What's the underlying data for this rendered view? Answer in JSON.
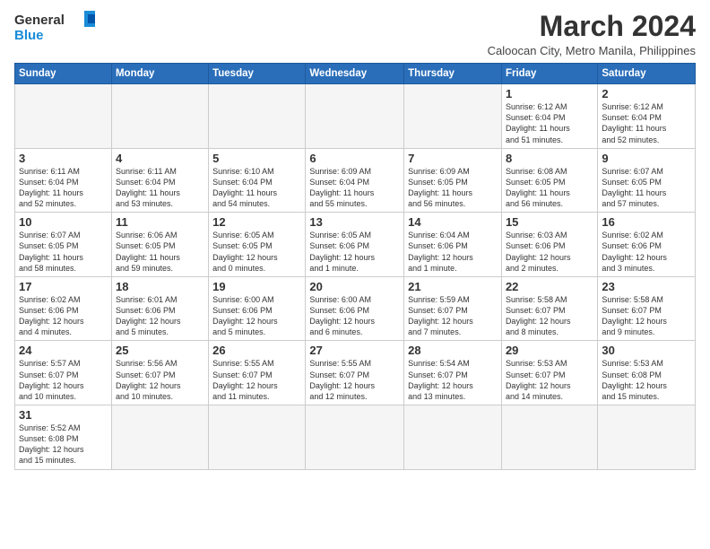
{
  "header": {
    "logo_general": "General",
    "logo_blue": "Blue",
    "month": "March 2024",
    "location": "Caloocan City, Metro Manila, Philippines"
  },
  "weekdays": [
    "Sunday",
    "Monday",
    "Tuesday",
    "Wednesday",
    "Thursday",
    "Friday",
    "Saturday"
  ],
  "weeks": [
    [
      {
        "day": "",
        "info": "",
        "empty": true
      },
      {
        "day": "",
        "info": "",
        "empty": true
      },
      {
        "day": "",
        "info": "",
        "empty": true
      },
      {
        "day": "",
        "info": "",
        "empty": true
      },
      {
        "day": "",
        "info": "",
        "empty": true
      },
      {
        "day": "1",
        "info": "Sunrise: 6:12 AM\nSunset: 6:04 PM\nDaylight: 11 hours\nand 51 minutes."
      },
      {
        "day": "2",
        "info": "Sunrise: 6:12 AM\nSunset: 6:04 PM\nDaylight: 11 hours\nand 52 minutes."
      }
    ],
    [
      {
        "day": "3",
        "info": "Sunrise: 6:11 AM\nSunset: 6:04 PM\nDaylight: 11 hours\nand 52 minutes."
      },
      {
        "day": "4",
        "info": "Sunrise: 6:11 AM\nSunset: 6:04 PM\nDaylight: 11 hours\nand 53 minutes."
      },
      {
        "day": "5",
        "info": "Sunrise: 6:10 AM\nSunset: 6:04 PM\nDaylight: 11 hours\nand 54 minutes."
      },
      {
        "day": "6",
        "info": "Sunrise: 6:09 AM\nSunset: 6:04 PM\nDaylight: 11 hours\nand 55 minutes."
      },
      {
        "day": "7",
        "info": "Sunrise: 6:09 AM\nSunset: 6:05 PM\nDaylight: 11 hours\nand 56 minutes."
      },
      {
        "day": "8",
        "info": "Sunrise: 6:08 AM\nSunset: 6:05 PM\nDaylight: 11 hours\nand 56 minutes."
      },
      {
        "day": "9",
        "info": "Sunrise: 6:07 AM\nSunset: 6:05 PM\nDaylight: 11 hours\nand 57 minutes."
      }
    ],
    [
      {
        "day": "10",
        "info": "Sunrise: 6:07 AM\nSunset: 6:05 PM\nDaylight: 11 hours\nand 58 minutes."
      },
      {
        "day": "11",
        "info": "Sunrise: 6:06 AM\nSunset: 6:05 PM\nDaylight: 11 hours\nand 59 minutes."
      },
      {
        "day": "12",
        "info": "Sunrise: 6:05 AM\nSunset: 6:05 PM\nDaylight: 12 hours\nand 0 minutes."
      },
      {
        "day": "13",
        "info": "Sunrise: 6:05 AM\nSunset: 6:06 PM\nDaylight: 12 hours\nand 1 minute."
      },
      {
        "day": "14",
        "info": "Sunrise: 6:04 AM\nSunset: 6:06 PM\nDaylight: 12 hours\nand 1 minute."
      },
      {
        "day": "15",
        "info": "Sunrise: 6:03 AM\nSunset: 6:06 PM\nDaylight: 12 hours\nand 2 minutes."
      },
      {
        "day": "16",
        "info": "Sunrise: 6:02 AM\nSunset: 6:06 PM\nDaylight: 12 hours\nand 3 minutes."
      }
    ],
    [
      {
        "day": "17",
        "info": "Sunrise: 6:02 AM\nSunset: 6:06 PM\nDaylight: 12 hours\nand 4 minutes."
      },
      {
        "day": "18",
        "info": "Sunrise: 6:01 AM\nSunset: 6:06 PM\nDaylight: 12 hours\nand 5 minutes."
      },
      {
        "day": "19",
        "info": "Sunrise: 6:00 AM\nSunset: 6:06 PM\nDaylight: 12 hours\nand 5 minutes."
      },
      {
        "day": "20",
        "info": "Sunrise: 6:00 AM\nSunset: 6:06 PM\nDaylight: 12 hours\nand 6 minutes."
      },
      {
        "day": "21",
        "info": "Sunrise: 5:59 AM\nSunset: 6:07 PM\nDaylight: 12 hours\nand 7 minutes."
      },
      {
        "day": "22",
        "info": "Sunrise: 5:58 AM\nSunset: 6:07 PM\nDaylight: 12 hours\nand 8 minutes."
      },
      {
        "day": "23",
        "info": "Sunrise: 5:58 AM\nSunset: 6:07 PM\nDaylight: 12 hours\nand 9 minutes."
      }
    ],
    [
      {
        "day": "24",
        "info": "Sunrise: 5:57 AM\nSunset: 6:07 PM\nDaylight: 12 hours\nand 10 minutes."
      },
      {
        "day": "25",
        "info": "Sunrise: 5:56 AM\nSunset: 6:07 PM\nDaylight: 12 hours\nand 10 minutes."
      },
      {
        "day": "26",
        "info": "Sunrise: 5:55 AM\nSunset: 6:07 PM\nDaylight: 12 hours\nand 11 minutes."
      },
      {
        "day": "27",
        "info": "Sunrise: 5:55 AM\nSunset: 6:07 PM\nDaylight: 12 hours\nand 12 minutes."
      },
      {
        "day": "28",
        "info": "Sunrise: 5:54 AM\nSunset: 6:07 PM\nDaylight: 12 hours\nand 13 minutes."
      },
      {
        "day": "29",
        "info": "Sunrise: 5:53 AM\nSunset: 6:07 PM\nDaylight: 12 hours\nand 14 minutes."
      },
      {
        "day": "30",
        "info": "Sunrise: 5:53 AM\nSunset: 6:08 PM\nDaylight: 12 hours\nand 15 minutes."
      }
    ],
    [
      {
        "day": "31",
        "info": "Sunrise: 5:52 AM\nSunset: 6:08 PM\nDaylight: 12 hours\nand 15 minutes."
      },
      {
        "day": "",
        "info": "",
        "empty": true
      },
      {
        "day": "",
        "info": "",
        "empty": true
      },
      {
        "day": "",
        "info": "",
        "empty": true
      },
      {
        "day": "",
        "info": "",
        "empty": true
      },
      {
        "day": "",
        "info": "",
        "empty": true
      },
      {
        "day": "",
        "info": "",
        "empty": true
      }
    ]
  ]
}
